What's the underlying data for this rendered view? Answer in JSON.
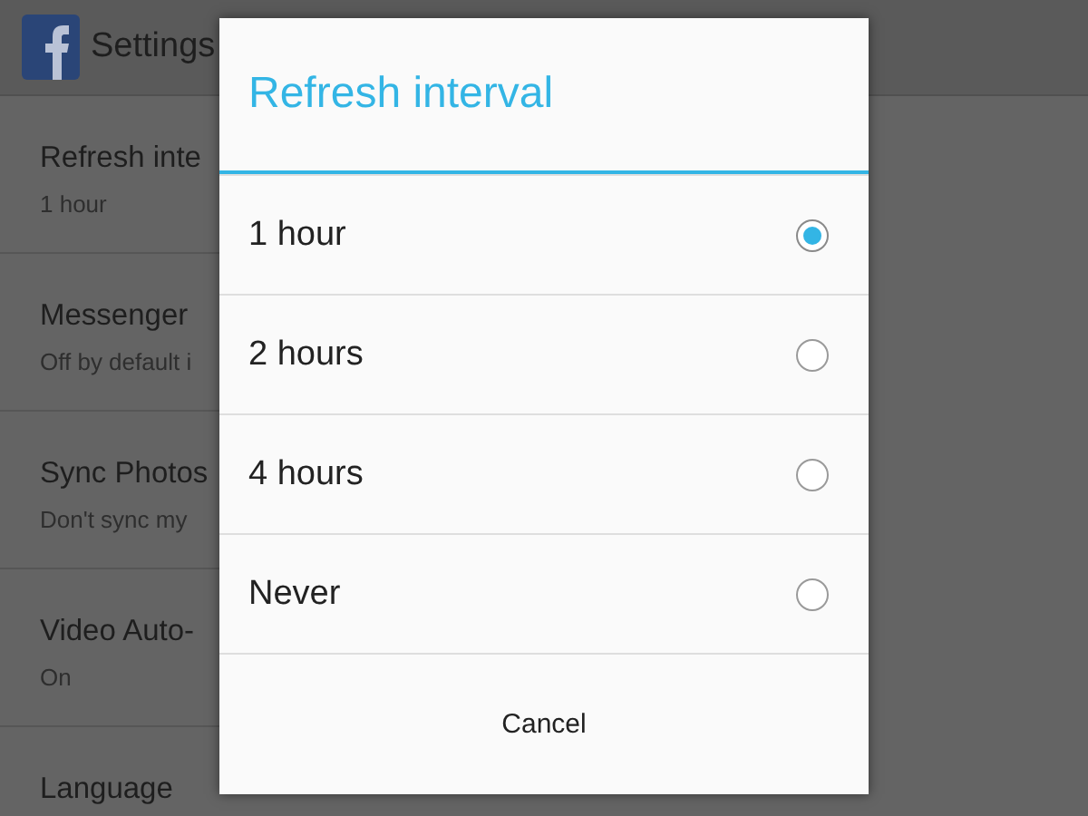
{
  "app_bar": {
    "title": "Settings"
  },
  "settings": [
    {
      "title": "Refresh inte",
      "summary": "1 hour"
    },
    {
      "title": "Messenger",
      "summary": "Off by default i"
    },
    {
      "title": "Sync Photos",
      "summary": "Don't sync my"
    },
    {
      "title": "Video Auto-",
      "summary": "On"
    },
    {
      "title": "Language"
    }
  ],
  "dialog": {
    "title": "Refresh interval",
    "options": [
      {
        "label": "1 hour",
        "selected": true
      },
      {
        "label": "2 hours",
        "selected": false
      },
      {
        "label": "4 hours",
        "selected": false
      },
      {
        "label": "Never",
        "selected": false
      }
    ],
    "cancel": "Cancel"
  }
}
